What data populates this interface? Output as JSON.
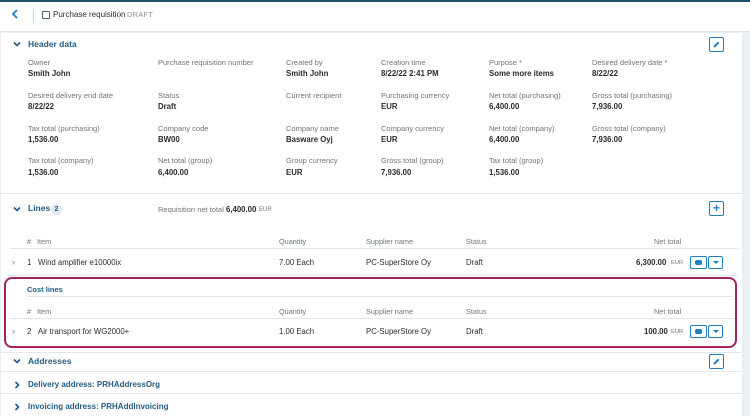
{
  "topbar": {
    "back_icon": "chevron-left-icon",
    "doc_icon": "document-icon",
    "title": "Purchase requisition",
    "status": "DRAFT"
  },
  "header_data": {
    "title": "Header data",
    "fields": [
      {
        "label": "Owner",
        "value": "Smith John"
      },
      {
        "label": "Purchase requisition number",
        "value": ""
      },
      {
        "label": "Created by",
        "value": "Smith John"
      },
      {
        "label": "Creation time",
        "value": "8/22/22 2:41 PM"
      },
      {
        "label": "Purpose *",
        "value": "Some more items"
      },
      {
        "label": "Desired delivery date *",
        "value": "8/22/22"
      },
      {
        "label": "Desired delivery end date",
        "value": "8/22/22"
      },
      {
        "label": "Status",
        "value": "Draft"
      },
      {
        "label": "Current recipient",
        "value": ""
      },
      {
        "label": "Purchasing currency",
        "value": "EUR"
      },
      {
        "label": "Net total (purchasing)",
        "value": "6,400.00"
      },
      {
        "label": "Gross total (purchasing)",
        "value": "7,936.00"
      },
      {
        "label": "Tax total (purchasing)",
        "value": "1,536.00"
      },
      {
        "label": "Company code",
        "value": "BW00"
      },
      {
        "label": "Company name",
        "value": "Basware Oyj"
      },
      {
        "label": "Company currency",
        "value": "EUR"
      },
      {
        "label": "Net total (company)",
        "value": "6,400.00"
      },
      {
        "label": "Gross total (company)",
        "value": "7,936.00"
      },
      {
        "label": "Tax total (company)",
        "value": "1,536.00"
      },
      {
        "label": "Net total (group)",
        "value": "6,400.00"
      },
      {
        "label": "Group currency",
        "value": "EUR"
      },
      {
        "label": "Gross total (group)",
        "value": "7,936.00"
      },
      {
        "label": "Tax total (group)",
        "value": "1,536.00"
      }
    ]
  },
  "lines": {
    "title": "Lines",
    "count": "2",
    "req_net_label": "Requisition net total",
    "req_net_value": "6,400.00",
    "req_net_currency": "EUR",
    "columns": [
      "#",
      "Item",
      "Quantity",
      "Supplier name",
      "Status",
      "Net total"
    ],
    "rows": [
      {
        "num": "1",
        "item": "Wind amplifier e10000ix",
        "quantity": "7.00 Each",
        "supplier": "PC-SuperStore Oy",
        "status": "Draft",
        "net_total": "6,300.00",
        "currency": "EUR"
      }
    ]
  },
  "cost_lines": {
    "title": "Cost lines",
    "columns": [
      "#",
      "Item",
      "Quantity",
      "Supplier name",
      "Status",
      "Net total"
    ],
    "rows": [
      {
        "num": "2",
        "item": "Air transport for WG2000+",
        "quantity": "1.00 Each",
        "supplier": "PC-SuperStore Oy",
        "status": "Draft",
        "net_total": "100.00",
        "currency": "EUR"
      }
    ]
  },
  "addresses": {
    "title": "Addresses",
    "delivery": "Delivery address: PRHAddressOrg",
    "invoicing": "Invoicing address: PRHAddInvoicing"
  },
  "colors": {
    "accent": "#1f7fbf",
    "heading": "#1f5c85",
    "highlight": "#a1225d"
  }
}
